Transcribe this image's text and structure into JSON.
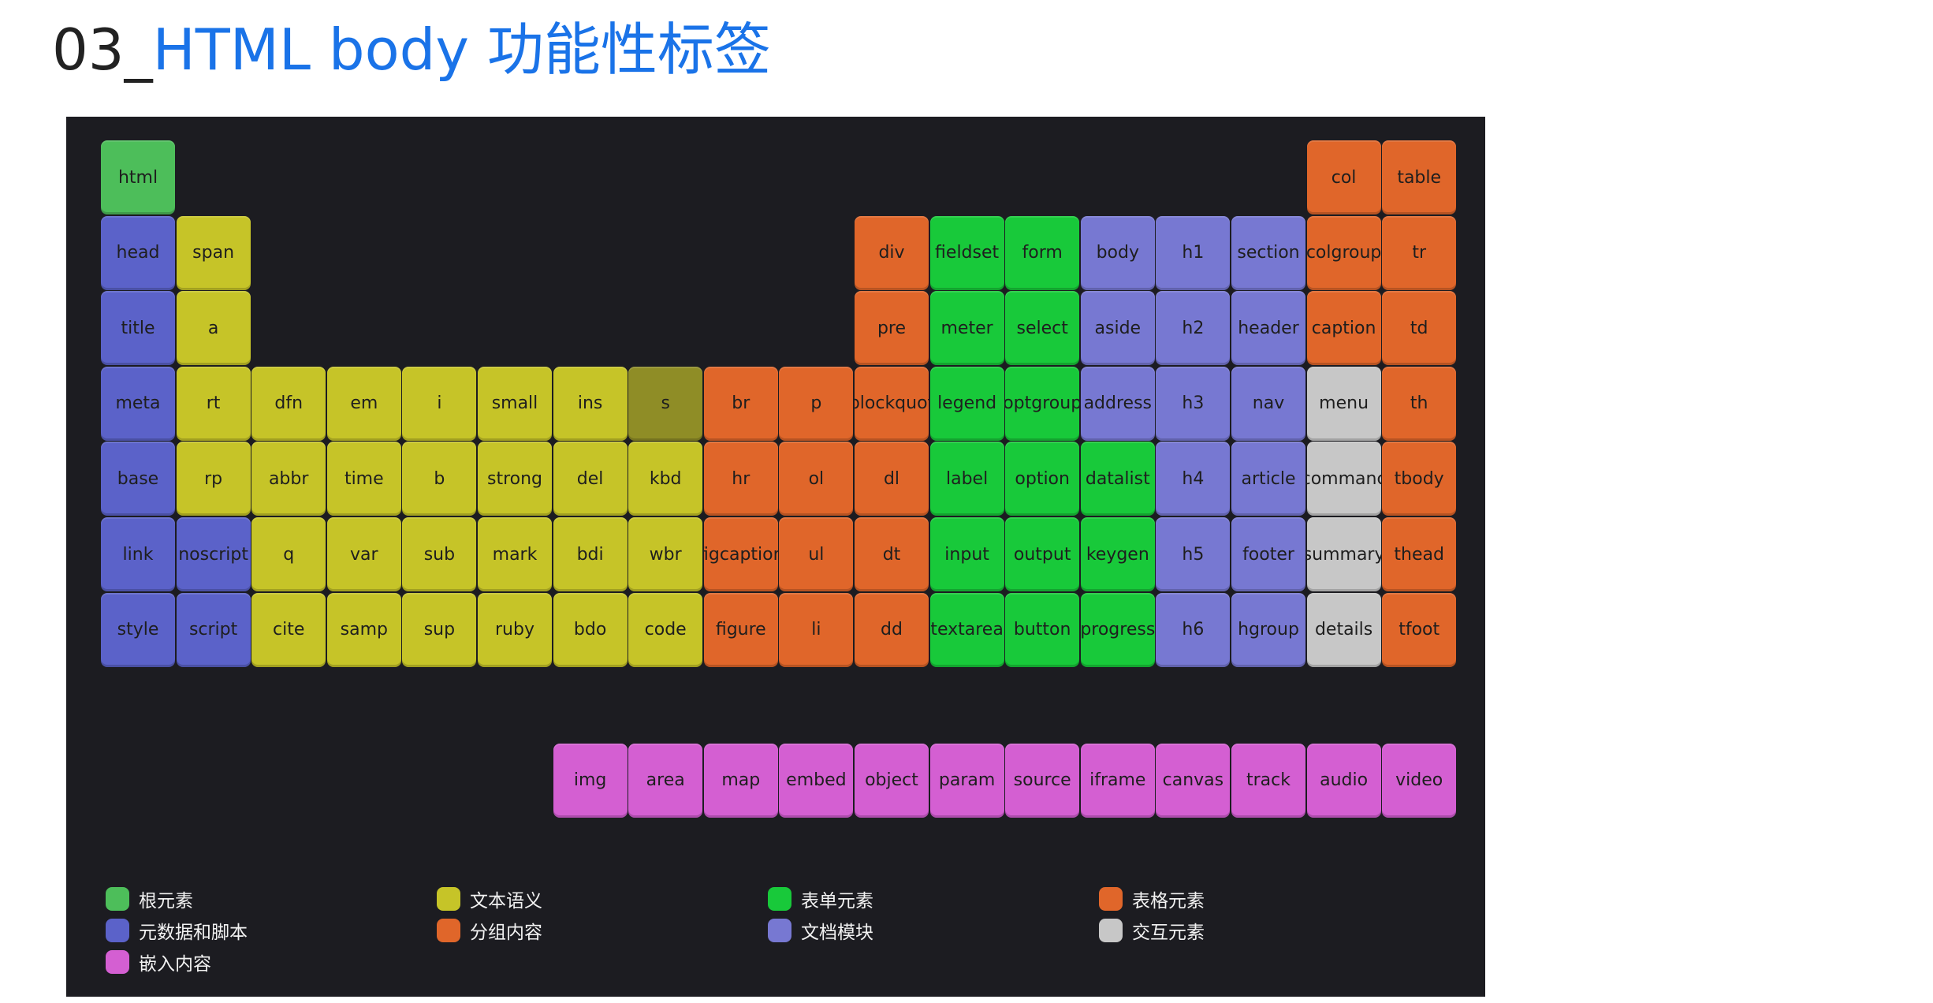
{
  "header": {
    "title_prefix": "03_",
    "title_main": "HTML body 功能性标签"
  },
  "colors": {
    "root": "#4dbe5a",
    "meta": "#5b62c9",
    "text": "#c6c428",
    "text_dark": "#8f8d26",
    "group": "#e0662a",
    "form": "#18c93a",
    "section": "#7778d2",
    "table": "#e0662a",
    "interactive": "#c7c7c7",
    "embed": "#d45fd2"
  },
  "legend": [
    {
      "label": "根元素",
      "color": "root"
    },
    {
      "label": "元数据和脚本",
      "color": "meta"
    },
    {
      "label": "嵌入内容",
      "color": "embed"
    },
    {
      "label": "文本语义",
      "color": "text"
    },
    {
      "label": "分组内容",
      "color": "group"
    },
    {
      "label": "表单元素",
      "color": "form"
    },
    {
      "label": "文档模块",
      "color": "section"
    },
    {
      "label": "表格元素",
      "color": "table"
    },
    {
      "label": "交互元素",
      "color": "interactive"
    }
  ],
  "tiles": [
    {
      "label": "html",
      "col": 0,
      "row": 0,
      "color": "root"
    },
    {
      "label": "col",
      "col": 16,
      "row": 0,
      "color": "table"
    },
    {
      "label": "table",
      "col": 17,
      "row": 0,
      "color": "table"
    },
    {
      "label": "head",
      "col": 0,
      "row": 1,
      "color": "meta"
    },
    {
      "label": "span",
      "col": 1,
      "row": 1,
      "color": "text"
    },
    {
      "label": "div",
      "col": 10,
      "row": 1,
      "color": "group"
    },
    {
      "label": "fieldset",
      "col": 11,
      "row": 1,
      "color": "form"
    },
    {
      "label": "form",
      "col": 12,
      "row": 1,
      "color": "form"
    },
    {
      "label": "body",
      "col": 13,
      "row": 1,
      "color": "section"
    },
    {
      "label": "h1",
      "col": 14,
      "row": 1,
      "color": "section"
    },
    {
      "label": "section",
      "col": 15,
      "row": 1,
      "color": "section"
    },
    {
      "label": "colgroup",
      "col": 16,
      "row": 1,
      "color": "table"
    },
    {
      "label": "tr",
      "col": 17,
      "row": 1,
      "color": "table"
    },
    {
      "label": "title",
      "col": 0,
      "row": 2,
      "color": "meta"
    },
    {
      "label": "a",
      "col": 1,
      "row": 2,
      "color": "text"
    },
    {
      "label": "pre",
      "col": 10,
      "row": 2,
      "color": "group"
    },
    {
      "label": "meter",
      "col": 11,
      "row": 2,
      "color": "form"
    },
    {
      "label": "select",
      "col": 12,
      "row": 2,
      "color": "form"
    },
    {
      "label": "aside",
      "col": 13,
      "row": 2,
      "color": "section"
    },
    {
      "label": "h2",
      "col": 14,
      "row": 2,
      "color": "section"
    },
    {
      "label": "header",
      "col": 15,
      "row": 2,
      "color": "section"
    },
    {
      "label": "caption",
      "col": 16,
      "row": 2,
      "color": "table"
    },
    {
      "label": "td",
      "col": 17,
      "row": 2,
      "color": "table"
    },
    {
      "label": "meta",
      "col": 0,
      "row": 3,
      "color": "meta"
    },
    {
      "label": "rt",
      "col": 1,
      "row": 3,
      "color": "text"
    },
    {
      "label": "dfn",
      "col": 2,
      "row": 3,
      "color": "text"
    },
    {
      "label": "em",
      "col": 3,
      "row": 3,
      "color": "text"
    },
    {
      "label": "i",
      "col": 4,
      "row": 3,
      "color": "text"
    },
    {
      "label": "small",
      "col": 5,
      "row": 3,
      "color": "text"
    },
    {
      "label": "ins",
      "col": 6,
      "row": 3,
      "color": "text"
    },
    {
      "label": "s",
      "col": 7,
      "row": 3,
      "color": "text_dark"
    },
    {
      "label": "br",
      "col": 8,
      "row": 3,
      "color": "group"
    },
    {
      "label": "p",
      "col": 9,
      "row": 3,
      "color": "group"
    },
    {
      "label": "blockquot",
      "col": 10,
      "row": 3,
      "color": "group"
    },
    {
      "label": "legend",
      "col": 11,
      "row": 3,
      "color": "form"
    },
    {
      "label": "optgroup",
      "col": 12,
      "row": 3,
      "color": "form"
    },
    {
      "label": "address",
      "col": 13,
      "row": 3,
      "color": "section"
    },
    {
      "label": "h3",
      "col": 14,
      "row": 3,
      "color": "section"
    },
    {
      "label": "nav",
      "col": 15,
      "row": 3,
      "color": "section"
    },
    {
      "label": "menu",
      "col": 16,
      "row": 3,
      "color": "interactive"
    },
    {
      "label": "th",
      "col": 17,
      "row": 3,
      "color": "table"
    },
    {
      "label": "base",
      "col": 0,
      "row": 4,
      "color": "meta"
    },
    {
      "label": "rp",
      "col": 1,
      "row": 4,
      "color": "text"
    },
    {
      "label": "abbr",
      "col": 2,
      "row": 4,
      "color": "text"
    },
    {
      "label": "time",
      "col": 3,
      "row": 4,
      "color": "text"
    },
    {
      "label": "b",
      "col": 4,
      "row": 4,
      "color": "text"
    },
    {
      "label": "strong",
      "col": 5,
      "row": 4,
      "color": "text"
    },
    {
      "label": "del",
      "col": 6,
      "row": 4,
      "color": "text"
    },
    {
      "label": "kbd",
      "col": 7,
      "row": 4,
      "color": "text"
    },
    {
      "label": "hr",
      "col": 8,
      "row": 4,
      "color": "group"
    },
    {
      "label": "ol",
      "col": 9,
      "row": 4,
      "color": "group"
    },
    {
      "label": "dl",
      "col": 10,
      "row": 4,
      "color": "group"
    },
    {
      "label": "label",
      "col": 11,
      "row": 4,
      "color": "form"
    },
    {
      "label": "option",
      "col": 12,
      "row": 4,
      "color": "form"
    },
    {
      "label": "datalist",
      "col": 13,
      "row": 4,
      "color": "form"
    },
    {
      "label": "h4",
      "col": 14,
      "row": 4,
      "color": "section"
    },
    {
      "label": "article",
      "col": 15,
      "row": 4,
      "color": "section"
    },
    {
      "label": "commanc",
      "col": 16,
      "row": 4,
      "color": "interactive"
    },
    {
      "label": "tbody",
      "col": 17,
      "row": 4,
      "color": "table"
    },
    {
      "label": "link",
      "col": 0,
      "row": 5,
      "color": "meta"
    },
    {
      "label": "noscript",
      "col": 1,
      "row": 5,
      "color": "meta"
    },
    {
      "label": "q",
      "col": 2,
      "row": 5,
      "color": "text"
    },
    {
      "label": "var",
      "col": 3,
      "row": 5,
      "color": "text"
    },
    {
      "label": "sub",
      "col": 4,
      "row": 5,
      "color": "text"
    },
    {
      "label": "mark",
      "col": 5,
      "row": 5,
      "color": "text"
    },
    {
      "label": "bdi",
      "col": 6,
      "row": 5,
      "color": "text"
    },
    {
      "label": "wbr",
      "col": 7,
      "row": 5,
      "color": "text"
    },
    {
      "label": "figcaption",
      "col": 8,
      "row": 5,
      "color": "group"
    },
    {
      "label": "ul",
      "col": 9,
      "row": 5,
      "color": "group"
    },
    {
      "label": "dt",
      "col": 10,
      "row": 5,
      "color": "group"
    },
    {
      "label": "input",
      "col": 11,
      "row": 5,
      "color": "form"
    },
    {
      "label": "output",
      "col": 12,
      "row": 5,
      "color": "form"
    },
    {
      "label": "keygen",
      "col": 13,
      "row": 5,
      "color": "form"
    },
    {
      "label": "h5",
      "col": 14,
      "row": 5,
      "color": "section"
    },
    {
      "label": "footer",
      "col": 15,
      "row": 5,
      "color": "section"
    },
    {
      "label": "summary",
      "col": 16,
      "row": 5,
      "color": "interactive"
    },
    {
      "label": "thead",
      "col": 17,
      "row": 5,
      "color": "table"
    },
    {
      "label": "style",
      "col": 0,
      "row": 6,
      "color": "meta"
    },
    {
      "label": "script",
      "col": 1,
      "row": 6,
      "color": "meta"
    },
    {
      "label": "cite",
      "col": 2,
      "row": 6,
      "color": "text"
    },
    {
      "label": "samp",
      "col": 3,
      "row": 6,
      "color": "text"
    },
    {
      "label": "sup",
      "col": 4,
      "row": 6,
      "color": "text"
    },
    {
      "label": "ruby",
      "col": 5,
      "row": 6,
      "color": "text"
    },
    {
      "label": "bdo",
      "col": 6,
      "row": 6,
      "color": "text"
    },
    {
      "label": "code",
      "col": 7,
      "row": 6,
      "color": "text"
    },
    {
      "label": "figure",
      "col": 8,
      "row": 6,
      "color": "group"
    },
    {
      "label": "li",
      "col": 9,
      "row": 6,
      "color": "group"
    },
    {
      "label": "dd",
      "col": 10,
      "row": 6,
      "color": "group"
    },
    {
      "label": "textarea",
      "col": 11,
      "row": 6,
      "color": "form"
    },
    {
      "label": "button",
      "col": 12,
      "row": 6,
      "color": "form"
    },
    {
      "label": "progress",
      "col": 13,
      "row": 6,
      "color": "form"
    },
    {
      "label": "h6",
      "col": 14,
      "row": 6,
      "color": "section"
    },
    {
      "label": "hgroup",
      "col": 15,
      "row": 6,
      "color": "section"
    },
    {
      "label": "details",
      "col": 16,
      "row": 6,
      "color": "interactive"
    },
    {
      "label": "tfoot",
      "col": 17,
      "row": 6,
      "color": "table"
    },
    {
      "label": "img",
      "col": 6,
      "row": 8,
      "color": "embed"
    },
    {
      "label": "area",
      "col": 7,
      "row": 8,
      "color": "embed"
    },
    {
      "label": "map",
      "col": 8,
      "row": 8,
      "color": "embed"
    },
    {
      "label": "embed",
      "col": 9,
      "row": 8,
      "color": "embed"
    },
    {
      "label": "object",
      "col": 10,
      "row": 8,
      "color": "embed"
    },
    {
      "label": "param",
      "col": 11,
      "row": 8,
      "color": "embed"
    },
    {
      "label": "source",
      "col": 12,
      "row": 8,
      "color": "embed"
    },
    {
      "label": "iframe",
      "col": 13,
      "row": 8,
      "color": "embed"
    },
    {
      "label": "canvas",
      "col": 14,
      "row": 8,
      "color": "embed"
    },
    {
      "label": "track",
      "col": 15,
      "row": 8,
      "color": "embed"
    },
    {
      "label": "audio",
      "col": 16,
      "row": 8,
      "color": "embed"
    },
    {
      "label": "video",
      "col": 17,
      "row": 8,
      "color": "embed"
    }
  ]
}
